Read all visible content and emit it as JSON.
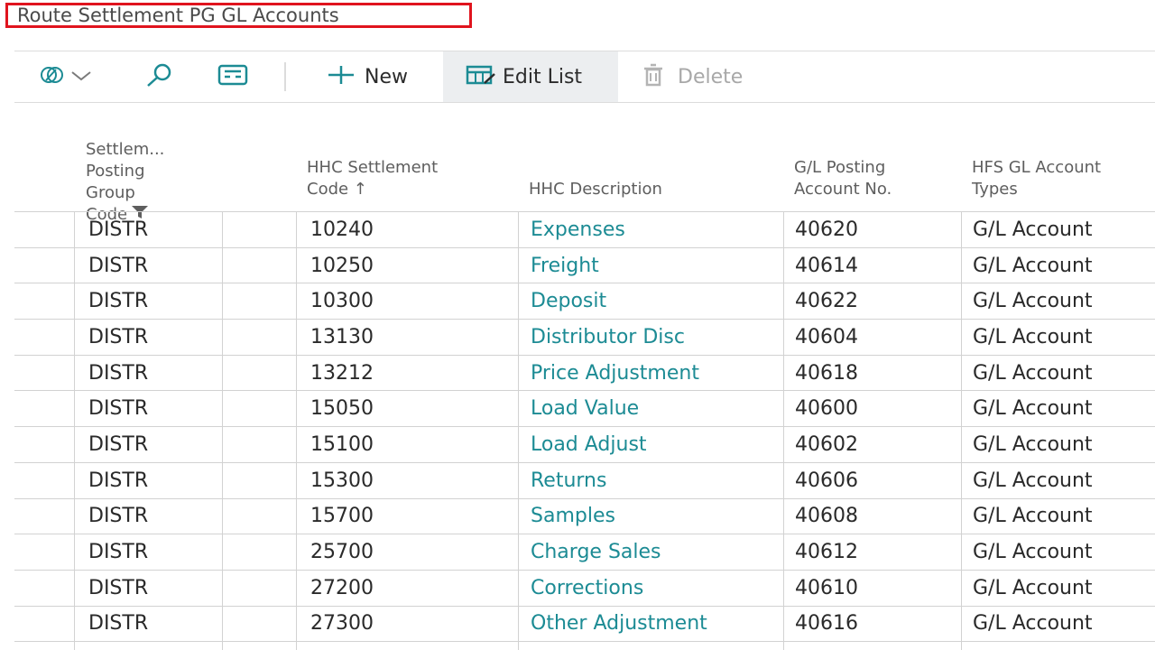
{
  "page": {
    "title": "Route Settlement PG GL Accounts"
  },
  "toolbar": {
    "new_label": "New",
    "edit_list_label": "Edit List",
    "delete_label": "Delete"
  },
  "columns": {
    "group_code": "Settlem...\nPosting\nGroup\nCode",
    "settlement_code": "HHC Settlement\nCode ↑",
    "description": "HHC Description",
    "posting_account": "G/L Posting\nAccount No.",
    "account_types": "HFS GL Account\nTypes"
  },
  "rows": [
    {
      "group": "DISTR",
      "code": "10240",
      "desc": "Expenses",
      "acct": "40620",
      "type": "G/L Account"
    },
    {
      "group": "DISTR",
      "code": "10250",
      "desc": "Freight",
      "acct": "40614",
      "type": "G/L Account"
    },
    {
      "group": "DISTR",
      "code": "10300",
      "desc": "Deposit",
      "acct": "40622",
      "type": "G/L Account"
    },
    {
      "group": "DISTR",
      "code": "13130",
      "desc": "Distributor Disc",
      "acct": "40604",
      "type": "G/L Account"
    },
    {
      "group": "DISTR",
      "code": "13212",
      "desc": "Price Adjustment",
      "acct": "40618",
      "type": "G/L Account"
    },
    {
      "group": "DISTR",
      "code": "15050",
      "desc": "Load Value",
      "acct": "40600",
      "type": "G/L Account"
    },
    {
      "group": "DISTR",
      "code": "15100",
      "desc": "Load Adjust",
      "acct": "40602",
      "type": "G/L Account"
    },
    {
      "group": "DISTR",
      "code": "15300",
      "desc": "Returns",
      "acct": "40606",
      "type": "G/L Account"
    },
    {
      "group": "DISTR",
      "code": "15700",
      "desc": "Samples",
      "acct": "40608",
      "type": "G/L Account"
    },
    {
      "group": "DISTR",
      "code": "25700",
      "desc": "Charge Sales",
      "acct": "40612",
      "type": "G/L Account"
    },
    {
      "group": "DISTR",
      "code": "27200",
      "desc": "Corrections",
      "acct": "40610",
      "type": "G/L Account"
    },
    {
      "group": "DISTR",
      "code": "27300",
      "desc": "Other Adjustment",
      "acct": "40616",
      "type": "G/L Account"
    }
  ],
  "colors": {
    "accent": "#1c8b94",
    "highlight_border": "#e0141e"
  }
}
